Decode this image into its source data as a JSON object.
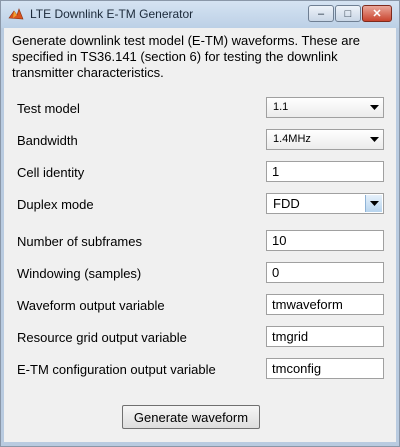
{
  "window": {
    "title": "LTE Downlink E-TM Generator",
    "controls": {
      "minimize": "–",
      "maximize": "□",
      "close": "✕"
    }
  },
  "description": "Generate downlink test model (E-TM) waveforms. These are specified in TS36.141 (section 6) for testing the downlink transmitter characteristics.",
  "form": {
    "test_model": {
      "label": "Test model",
      "value": "1.1"
    },
    "bandwidth": {
      "label": "Bandwidth",
      "value": "1.4MHz"
    },
    "cell_identity": {
      "label": "Cell identity",
      "value": "1"
    },
    "duplex_mode": {
      "label": "Duplex mode",
      "value": "FDD"
    },
    "num_subframes": {
      "label": "Number of subframes",
      "value": "10"
    },
    "windowing": {
      "label": "Windowing (samples)",
      "value": "0"
    },
    "waveform_var": {
      "label": "Waveform output variable",
      "value": "tmwaveform"
    },
    "grid_var": {
      "label": "Resource grid output variable",
      "value": "tmgrid"
    },
    "config_var": {
      "label": "E-TM configuration output variable",
      "value": "tmconfig"
    }
  },
  "generate_button": {
    "label": "Generate waveform"
  },
  "icons": {
    "app": "matlab-logo-icon",
    "dropdown": "dropdown-arrow-icon"
  },
  "colors": {
    "titlebar": "#c7d8ec",
    "close": "#c9442e",
    "panel": "#f0f0f0"
  }
}
